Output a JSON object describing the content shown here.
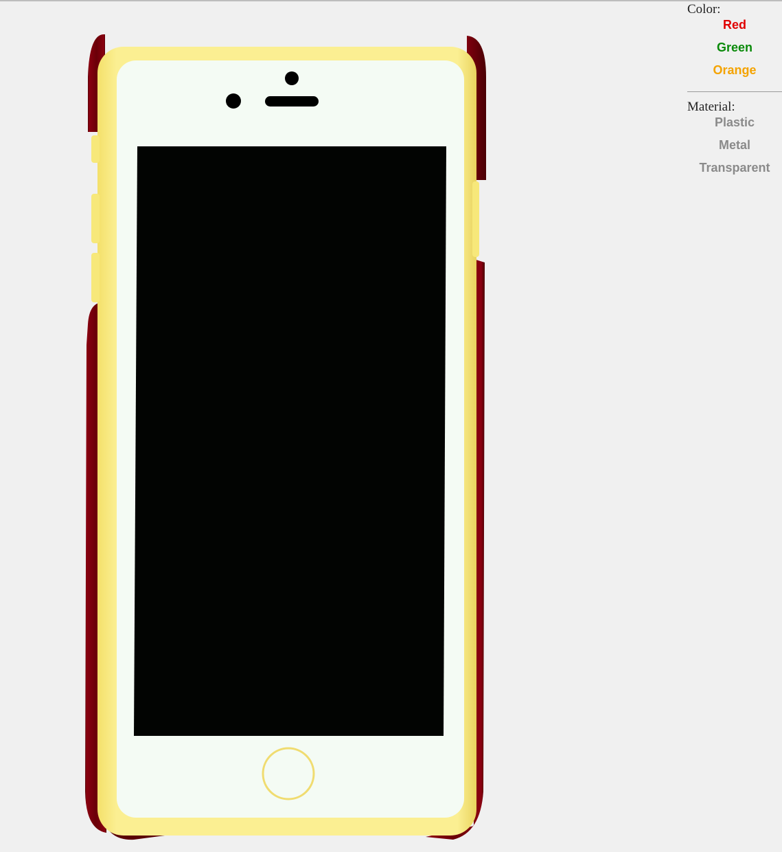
{
  "color_section": {
    "heading": "Color:",
    "options": [
      {
        "label": "Red",
        "color": "#e00000"
      },
      {
        "label": "Green",
        "color": "#0a8a0a"
      },
      {
        "label": "Orange",
        "color": "#f4a300"
      }
    ]
  },
  "material_section": {
    "heading": "Material:",
    "options": [
      {
        "label": "Plastic",
        "color": "#8a8a8a"
      },
      {
        "label": "Metal",
        "color": "#8a8a8a"
      },
      {
        "label": "Transparent",
        "color": "#8a8a8a"
      }
    ]
  },
  "model": {
    "case_color": "#7a0008",
    "bumper_color": "#f7e87a",
    "face_color": "#f4fbf4",
    "screen_color": "#020402",
    "accent_color": "#f0dc70",
    "background_color": "#f0f0f0"
  }
}
